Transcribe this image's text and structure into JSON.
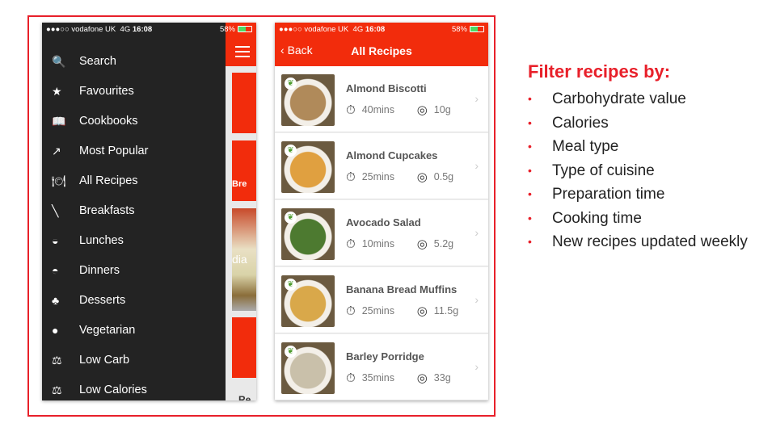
{
  "status": {
    "carrier": "●●●○○ vodafone UK",
    "network": "4G",
    "time": "16:08",
    "battery": "58%",
    "battery_level": 0.58
  },
  "menu": {
    "items": [
      {
        "label": "Search",
        "icon": "search-icon",
        "glyph": "🔍"
      },
      {
        "label": "Favourites",
        "icon": "star-icon",
        "glyph": "★"
      },
      {
        "label": "Cookbooks",
        "icon": "book-icon",
        "glyph": "📖"
      },
      {
        "label": "Most Popular",
        "icon": "trend-icon",
        "glyph": "↗"
      },
      {
        "label": "All Recipes",
        "icon": "cutlery-icon",
        "glyph": "🍽"
      },
      {
        "label": "Breakfasts",
        "icon": "spoon-icon",
        "glyph": "╲"
      },
      {
        "label": "Lunches",
        "icon": "bowl-icon",
        "glyph": "◒"
      },
      {
        "label": "Dinners",
        "icon": "cloche-icon",
        "glyph": "◓"
      },
      {
        "label": "Desserts",
        "icon": "cherries-icon",
        "glyph": "♣"
      },
      {
        "label": "Vegetarian",
        "icon": "apple-icon",
        "glyph": "●"
      },
      {
        "label": "Low Carb",
        "icon": "scale-icon",
        "glyph": "⚖"
      },
      {
        "label": "Low Calories",
        "icon": "scale-icon",
        "glyph": "⚖"
      }
    ]
  },
  "peek": {
    "label1": "Bre",
    "label2": "Re",
    "img_text": "dia"
  },
  "recipes": {
    "back": "Back",
    "title": "All Recipes",
    "items": [
      {
        "name": "Almond Biscotti",
        "time": "40mins",
        "carbs": "10g",
        "color": "#b08a5a"
      },
      {
        "name": "Almond Cupcakes",
        "time": "25mins",
        "carbs": "0.5g",
        "color": "#e0a040"
      },
      {
        "name": "Avocado Salad",
        "time": "10mins",
        "carbs": "5.2g",
        "color": "#4d7a30"
      },
      {
        "name": "Banana Bread Muffins",
        "time": "25mins",
        "carbs": "11.5g",
        "color": "#d9a84a"
      },
      {
        "name": "Barley Porridge",
        "time": "35mins",
        "carbs": "33g",
        "color": "#c9c0aa"
      }
    ]
  },
  "side": {
    "title": "Filter recipes by:",
    "bullets": [
      "Carbohydrate value",
      "Calories",
      "Meal type",
      "Type of cuisine",
      "Preparation time",
      "Cooking time",
      "New recipes updated weekly"
    ]
  }
}
